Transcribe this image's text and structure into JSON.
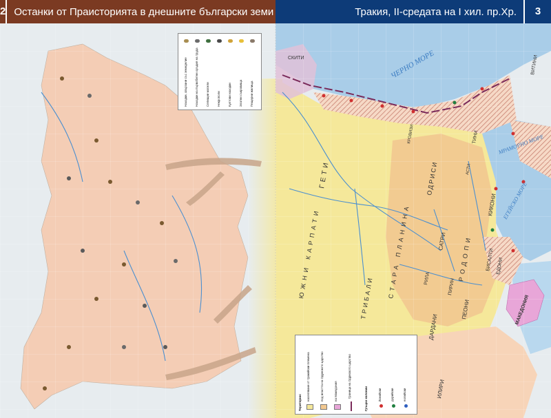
{
  "header": {
    "left_page_number": "2",
    "left_title": "Останки от Праисторията в днешните български земи",
    "right_title": "Тракия, II-средата на I хил. пр.Хр.",
    "right_page_number": "3"
  },
  "seas": {
    "black_sea": "ЧЕРНО МОРЕ",
    "marmara": "МРАМОРНО МОРЕ",
    "aegean": "ЕГЕЙСКО МОРЕ"
  },
  "tribes": [
    "СКИТИ",
    "ГЕТИ",
    "ТРИБАЛИ",
    "ОДРИСИ",
    "САТРИ",
    "КИКОНИ",
    "БИСАЛТИ",
    "ПЕОНИ",
    "ДАРДАНИ",
    "ИЛИРИ",
    "ТИНИ",
    "ВИТИНИ",
    "ЕДОНИ",
    "МАКЕДОНИЯ",
    "КРОВИЗИ",
    "АСТИ"
  ],
  "mountains": [
    "СТАРА ПЛАНИНА",
    "РОДОПИ",
    "ЮЖНИ КАРПАТИ",
    "РИЛА",
    "ПИРИН"
  ],
  "legend_left": {
    "items": [
      "Находки, свързани със земеделие",
      "Находки на първобитни оръдия на труда",
      "Селищни могили",
      "Некрополи",
      "Култови находки",
      "Златни съкровища",
      "Пещерни жилища"
    ]
  },
  "legend_right": {
    "title": "Територии:",
    "items": [
      "населявани от тракийски племена",
      "под властта на Одриското царство",
      "на Македония",
      "Граница на Одриското царство",
      "Гръцки колонии",
      "йонийски",
      "дорийски",
      "еолийски"
    ]
  },
  "colors": {
    "left_header": "#7b3a22",
    "right_header": "#0d3b78",
    "land_left": "#f4cdb5",
    "thrace_yellow": "#f5e89a",
    "odrysian": "#f2c890",
    "macedonia": "#e8a6d8",
    "sea": "#a9cde8",
    "river": "#4a8fd0",
    "hatch": "#c88070",
    "boundary": "#7a2a5a"
  }
}
